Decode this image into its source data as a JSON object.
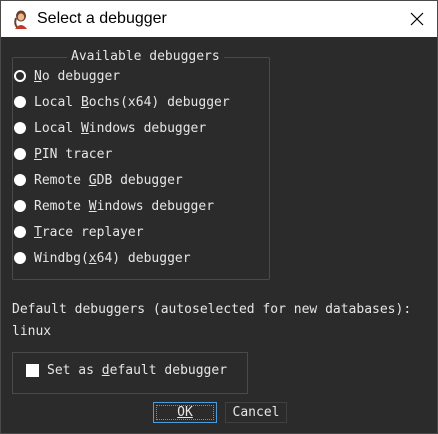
{
  "window": {
    "title": "Select a debugger",
    "icon": "ida-debugger-app-icon",
    "close_icon": "close-icon"
  },
  "group": {
    "title": "Available debuggers",
    "options": [
      {
        "label": "No debugger",
        "mnemonic": "N",
        "selected": true
      },
      {
        "label": "Local Bochs(x64) debugger",
        "mnemonic": "B",
        "selected": false
      },
      {
        "label": "Local Windows debugger",
        "mnemonic": "W",
        "selected": false
      },
      {
        "label": "PIN tracer",
        "mnemonic": "P",
        "selected": false
      },
      {
        "label": "Remote GDB debugger",
        "mnemonic": "G",
        "selected": false
      },
      {
        "label": "Remote Windows debugger",
        "mnemonic": "W",
        "selected": false
      },
      {
        "label": "Trace replayer",
        "mnemonic": "T",
        "selected": false
      },
      {
        "label": "Windbg(x64) debugger",
        "mnemonic": "x",
        "selected": false
      }
    ]
  },
  "defaults": {
    "label": "Default debuggers (autoselected for new databases):",
    "value": "linux"
  },
  "set_default": {
    "label": "Set as default debugger",
    "checked": false
  },
  "buttons": {
    "ok": "OK",
    "cancel": "Cancel"
  },
  "colors": {
    "background": "#2b2b2b",
    "text": "#e6e6e6",
    "focus_border": "#4d9bd8"
  }
}
